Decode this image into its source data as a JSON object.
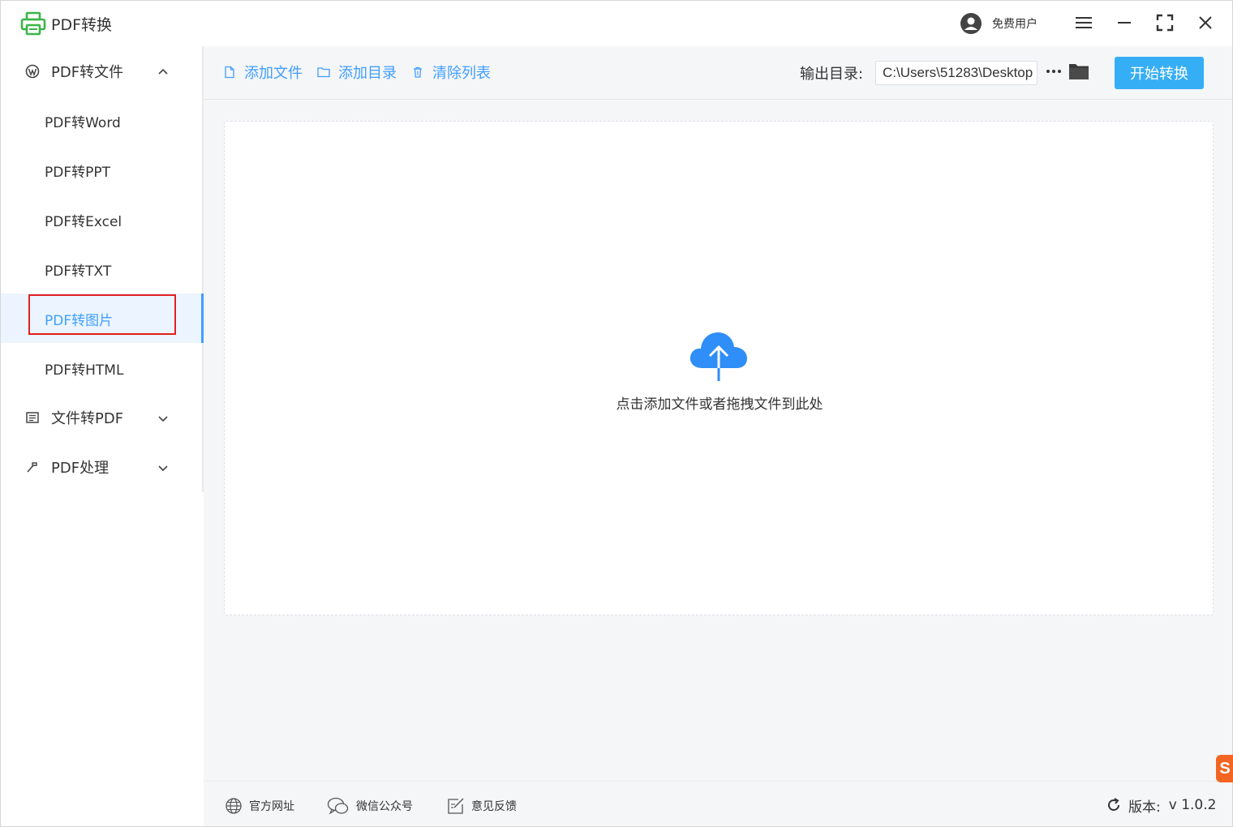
{
  "app": {
    "title": "PDF转换",
    "user_label": "免费用户"
  },
  "sidebar": {
    "groups": [
      {
        "label": "PDF转文件",
        "expanded": true
      },
      {
        "label": "文件转PDF",
        "expanded": false
      },
      {
        "label": "PDF处理",
        "expanded": false
      }
    ],
    "items": [
      {
        "label": "PDF转Word"
      },
      {
        "label": "PDF转PPT"
      },
      {
        "label": "PDF转Excel"
      },
      {
        "label": "PDF转TXT"
      },
      {
        "label": "PDF转图片",
        "active": true
      },
      {
        "label": "PDF转HTML"
      }
    ]
  },
  "toolbar": {
    "add_file": "添加文件",
    "add_dir": "添加目录",
    "clear_list": "清除列表",
    "output_label": "输出目录:",
    "output_path": "C:\\Users\\51283\\Desktop",
    "start_label": "开始转换"
  },
  "dropzone": {
    "hint": "点击添加文件或者拖拽文件到此处"
  },
  "footer": {
    "website": "官方网址",
    "wechat": "微信公众号",
    "feedback": "意见反馈",
    "version_label": "版本:",
    "version": "v 1.0.2"
  },
  "colors": {
    "accent": "#409eff",
    "start_button": "#36aef5",
    "logo_green": "#3bb54a",
    "highlight_border": "#e02020"
  },
  "corner_badge": "S"
}
